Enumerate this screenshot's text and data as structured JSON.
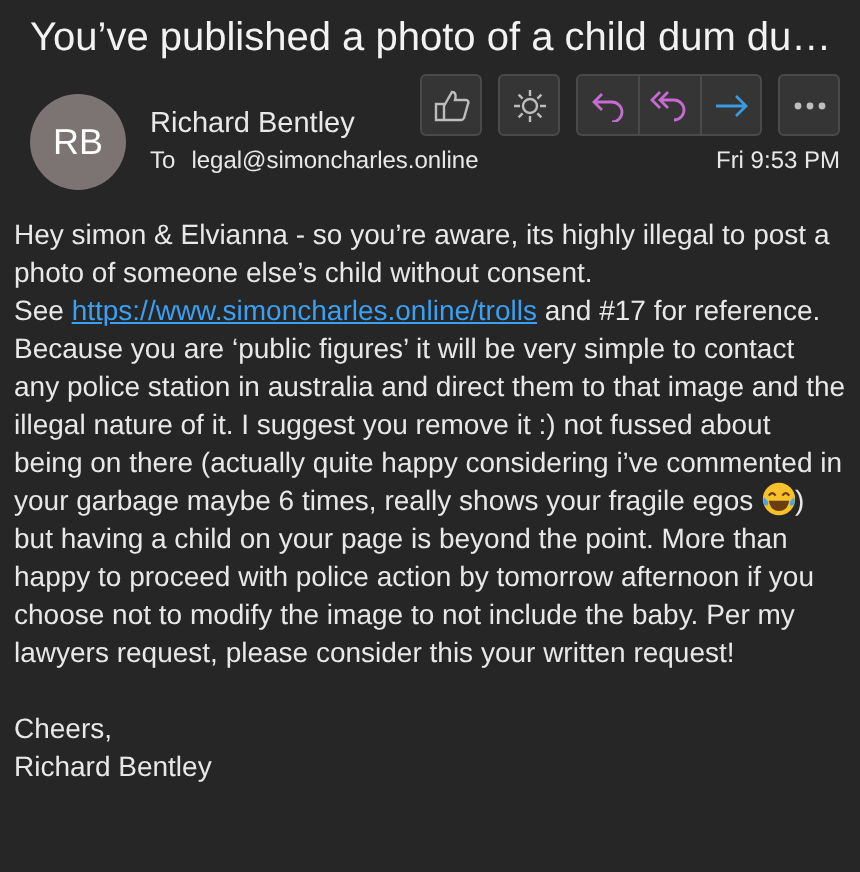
{
  "subject": "You’ve published a photo of a child dum du…",
  "sender": {
    "initials": "RB",
    "name": "Richard Bentley",
    "to_label": "To",
    "to": "legal@simoncharles.online",
    "time": "Fri 9:53 PM"
  },
  "actions": [
    {
      "kind": "like"
    },
    {
      "kind": "brightness"
    },
    {
      "kind": "reply"
    },
    {
      "kind": "reply-all"
    },
    {
      "kind": "forward"
    },
    {
      "kind": "more"
    }
  ],
  "body": [
    [
      {
        "kind": "text",
        "text": "Hey simon & Elvianna - so you’re aware, its highly illegal to post a photo of someone else’s child without consent."
      }
    ],
    [
      {
        "kind": "text",
        "text": "See "
      },
      {
        "kind": "link",
        "text": "https://www.simoncharles.online/trolls"
      },
      {
        "kind": "text",
        "text": " and #17 for reference. Because you are ‘public figures’ it will be very simple to contact any police station in australia and direct them to that image and the illegal nature of it. I suggest you remove it :) not fussed about being on there (actually quite happy considering i’ve commented in your garbage maybe 6 times, really shows your fragile egos "
      },
      {
        "kind": "emoji"
      },
      {
        "kind": "text",
        "text": ") but having a child on your page is beyond the point. More than happy to proceed with police action by tomorrow afternoon if you choose not to modify the image to not include the baby. Per my lawyers request, please consider this your written request!"
      }
    ],
    [
      {
        "kind": "gap"
      },
      {
        "kind": "text",
        "text": "Cheers,"
      }
    ],
    [
      {
        "kind": "text",
        "text": "Richard Bentley"
      }
    ]
  ]
}
